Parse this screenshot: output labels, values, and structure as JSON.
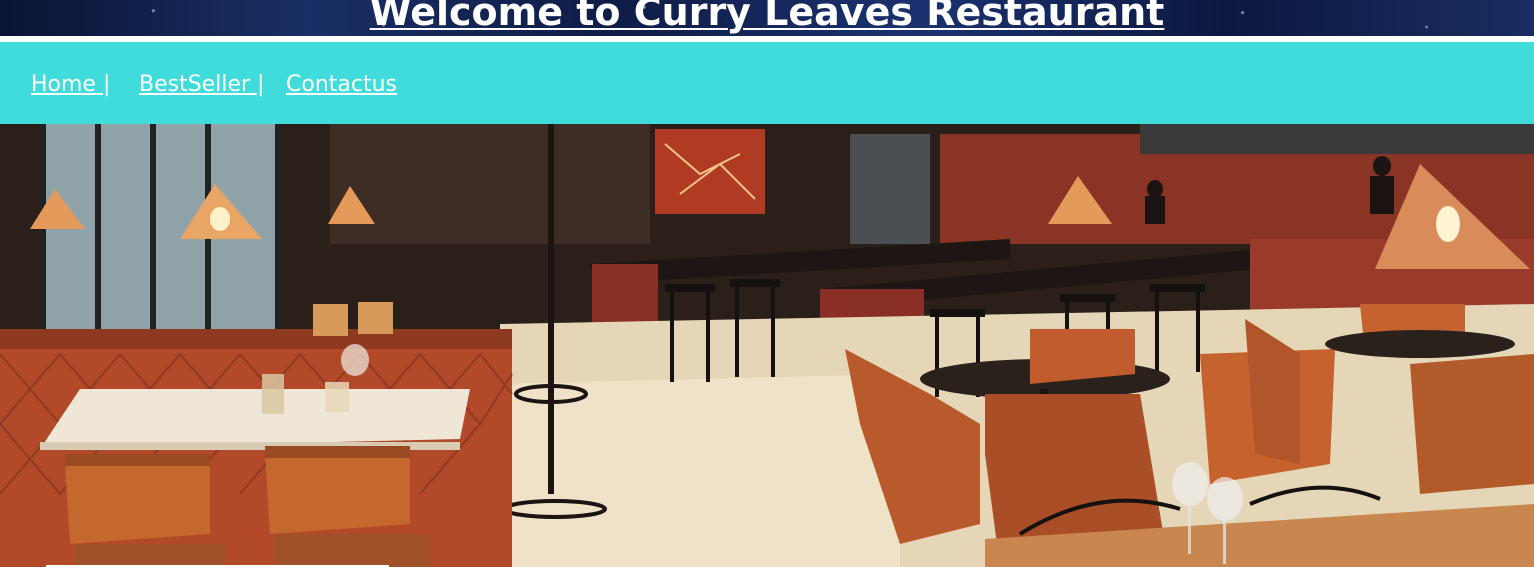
{
  "header": {
    "title": "Welcome to Curry Leaves Restaurant"
  },
  "nav": {
    "items": [
      {
        "label": "Home ",
        "separator": "|"
      },
      {
        "label": "BestSeller ",
        "separator": "|"
      },
      {
        "label": "Contactus",
        "separator": ""
      }
    ]
  },
  "hero": {
    "image": "restaurant-interior-photo"
  },
  "colors": {
    "nav_background": "#40dcdc",
    "header_background": "#0e1d45",
    "text": "#ffffff"
  }
}
